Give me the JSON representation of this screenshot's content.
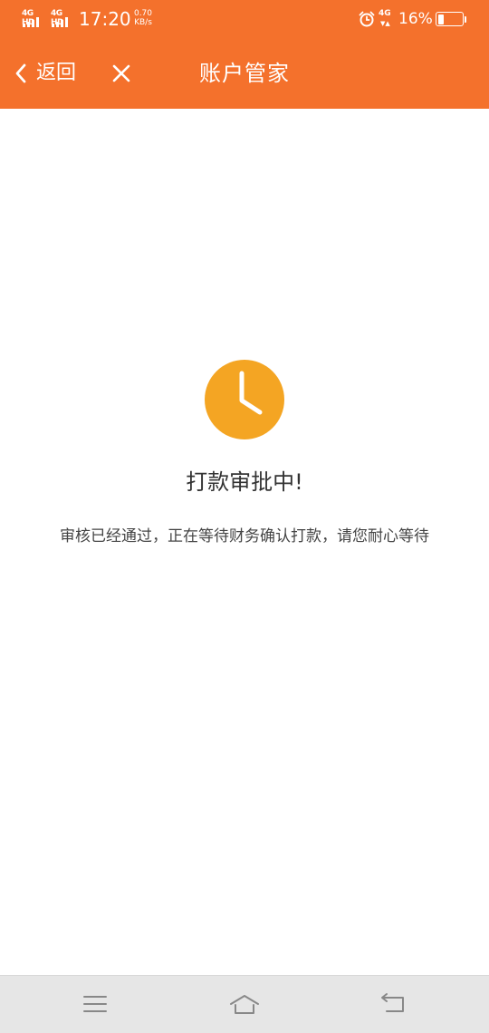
{
  "status_bar": {
    "sim1_network": "4G HD",
    "sim2_network": "4G HD",
    "time": "17:20",
    "net_speed_value": "0.70",
    "net_speed_unit": "KB/s",
    "data_network": "4G",
    "battery_percent": "16%",
    "battery_level": 0.16
  },
  "nav": {
    "back_label": "返回",
    "title": "账户管家"
  },
  "content": {
    "status_title": "打款审批中!",
    "status_message": "审核已经通过，正在等待财务确认打款，请您耐心等待"
  },
  "colors": {
    "header": "#f4712c",
    "clock": "#f4a523",
    "sys_nav": "#e6e6e6"
  },
  "icons": {
    "back": "chevron-left-icon",
    "close": "close-icon",
    "status": "clock-icon",
    "menu": "menu-icon",
    "home": "home-icon",
    "return": "return-icon"
  }
}
